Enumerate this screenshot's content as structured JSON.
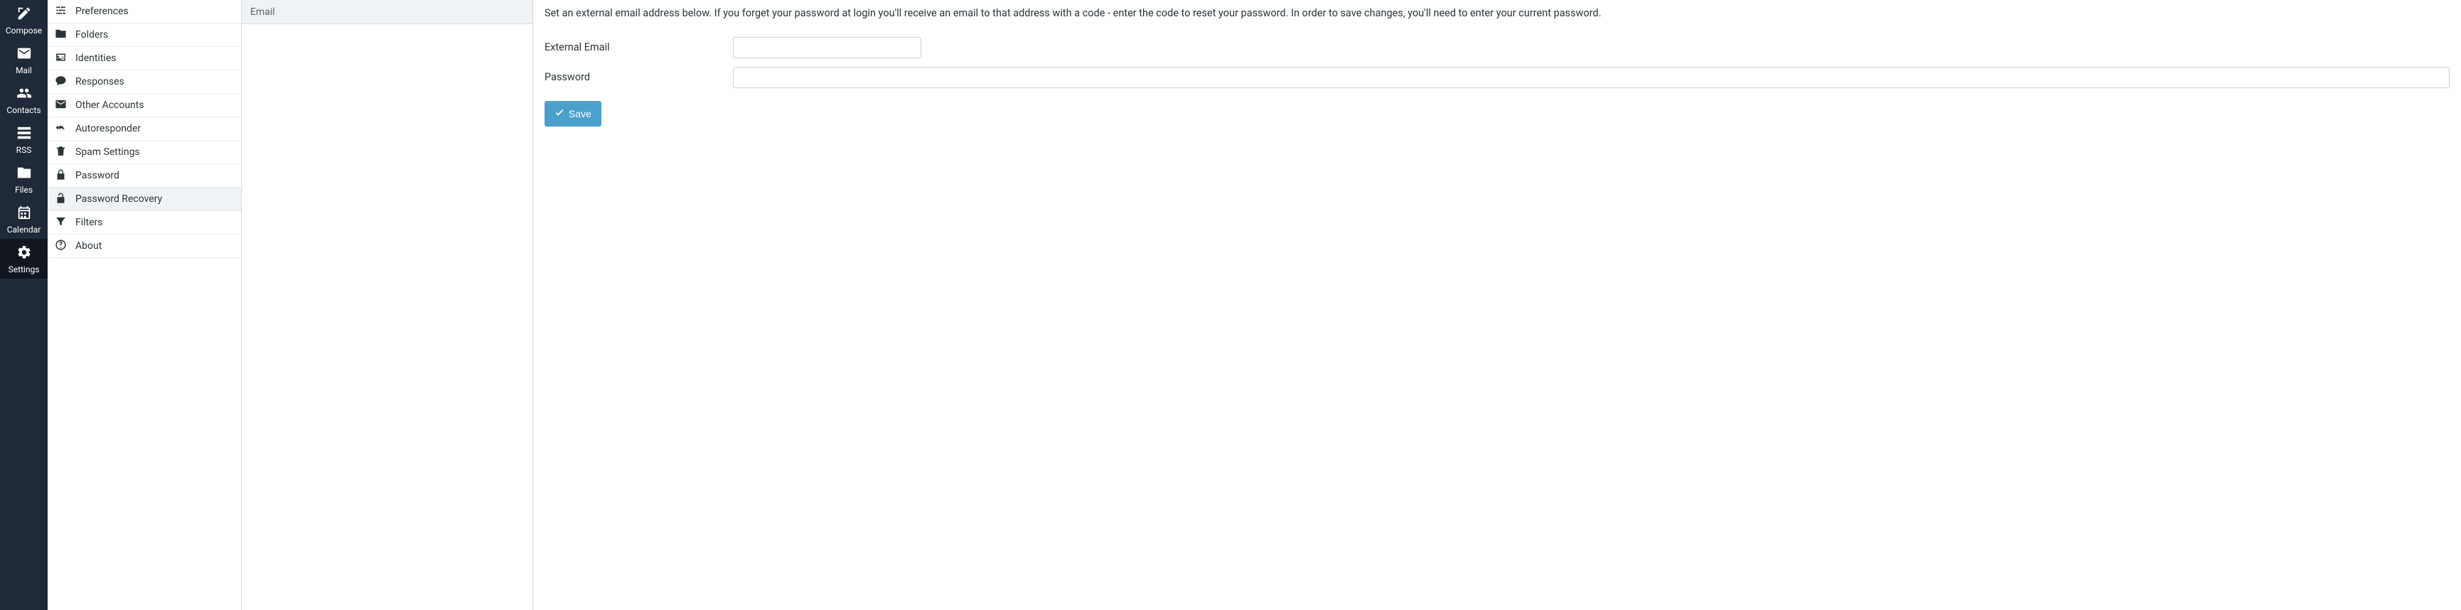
{
  "nav": {
    "compose": {
      "label": "Compose"
    },
    "mail": {
      "label": "Mail"
    },
    "contacts": {
      "label": "Contacts"
    },
    "rss": {
      "label": "RSS"
    },
    "files": {
      "label": "Files"
    },
    "calendar": {
      "label": "Calendar"
    },
    "settings": {
      "label": "Settings"
    }
  },
  "settings_list": {
    "preferences": {
      "label": "Preferences"
    },
    "folders": {
      "label": "Folders"
    },
    "identities": {
      "label": "Identities"
    },
    "responses": {
      "label": "Responses"
    },
    "other_accounts": {
      "label": "Other Accounts"
    },
    "autoresponder": {
      "label": "Autoresponder"
    },
    "spam_settings": {
      "label": "Spam Settings"
    },
    "password": {
      "label": "Password"
    },
    "password_recovery": {
      "label": "Password Recovery"
    },
    "filters": {
      "label": "Filters"
    },
    "about": {
      "label": "About"
    }
  },
  "mid": {
    "header": "Email"
  },
  "content": {
    "instructions": "Set an external email address below. If you forget your password at login you'll receive an email to that address with a code - enter the code to reset your password. In order to save changes, you'll need to enter your current password.",
    "external_email_label": "External Email",
    "external_email_value": "",
    "password_label": "Password",
    "password_value": "",
    "save_label": "Save"
  }
}
